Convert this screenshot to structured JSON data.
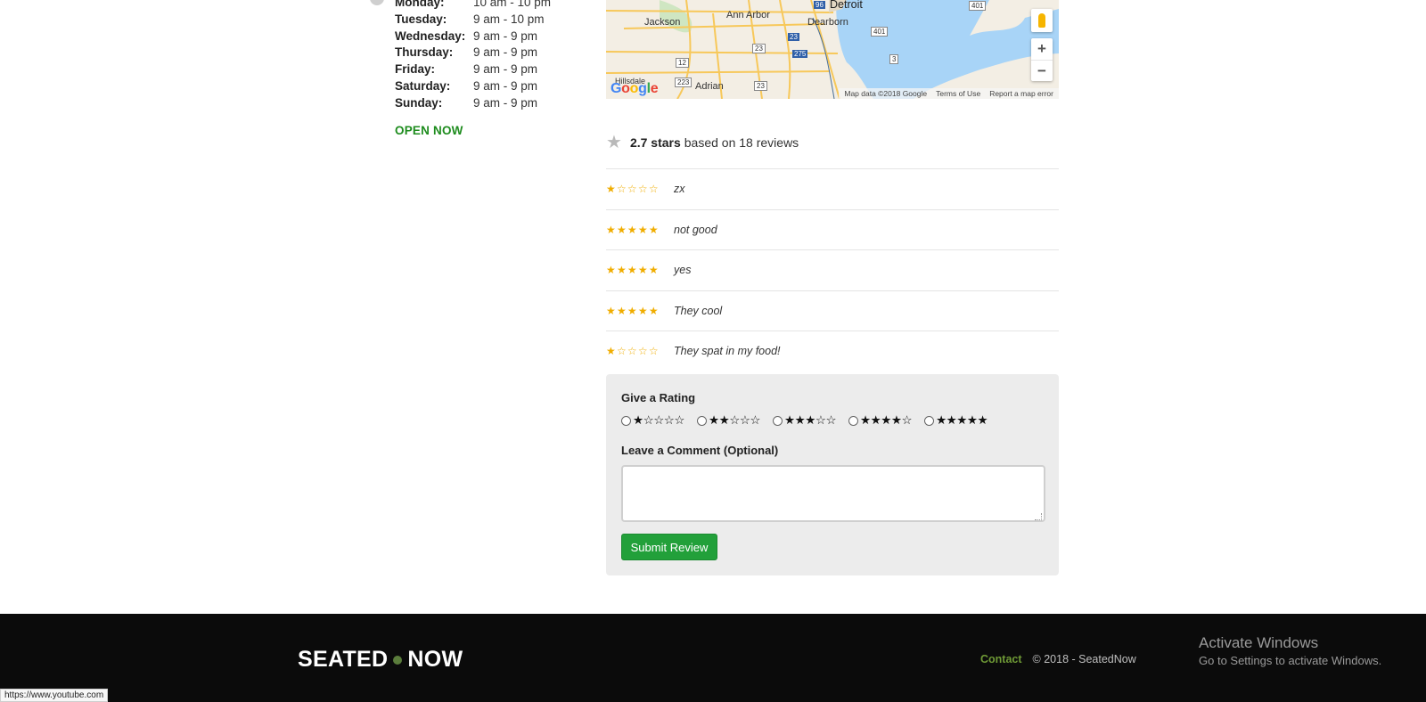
{
  "hours": {
    "rows": [
      {
        "day": "Monday:",
        "time": "10 am - 10 pm"
      },
      {
        "day": "Tuesday:",
        "time": "9 am - 10 pm"
      },
      {
        "day": "Wednesday:",
        "time": "9 am - 9 pm"
      },
      {
        "day": "Thursday:",
        "time": "9 am - 9 pm"
      },
      {
        "day": "Friday:",
        "time": "9 am - 9 pm"
      },
      {
        "day": "Saturday:",
        "time": "9 am - 9 pm"
      },
      {
        "day": "Sunday:",
        "time": "9 am - 9 pm"
      }
    ],
    "status": "OPEN NOW",
    "status_color": "#1e8c1e"
  },
  "map": {
    "cities": [
      "Jackson",
      "Ann Arbor",
      "Detroit",
      "Dearborn",
      "Adrian",
      "Hillsdale"
    ],
    "road_labels": [
      "96",
      "401",
      "401",
      "12",
      "23",
      "275",
      "3",
      "223",
      "23",
      "23"
    ],
    "google_logo": "Google",
    "footer": [
      "Map data ©2018 Google",
      "Terms of Use",
      "Report a map error"
    ],
    "zoom_in": "+",
    "zoom_out": "−",
    "pegman_icon": "street-view-pegman-icon"
  },
  "reviews": {
    "summary": {
      "rating_text": "2.7 stars",
      "suffix": "based on 18 reviews",
      "average": 2.7,
      "count": 18,
      "icon": "star-icon"
    },
    "items": [
      {
        "stars": "★☆☆☆☆",
        "rating": 1,
        "text": "zx"
      },
      {
        "stars": "★★★★★",
        "rating": 5,
        "text": "not good"
      },
      {
        "stars": "★★★★★",
        "rating": 5,
        "text": "yes"
      },
      {
        "stars": "★★★★★",
        "rating": 5,
        "text": "They cool"
      },
      {
        "stars": "★☆☆☆☆",
        "rating": 1,
        "text": "They spat in my food!"
      }
    ],
    "star_color": "#f0ad00"
  },
  "form": {
    "rating_label": "Give a Rating",
    "options": [
      {
        "value": 1,
        "stars": "★☆☆☆☆"
      },
      {
        "value": 2,
        "stars": "★★☆☆☆"
      },
      {
        "value": 3,
        "stars": "★★★☆☆"
      },
      {
        "value": 4,
        "stars": "★★★★☆"
      },
      {
        "value": 5,
        "stars": "★★★★★"
      }
    ],
    "comment_label": "Leave a Comment (Optional)",
    "comment_value": "",
    "submit_label": "Submit Review",
    "submit_color": "#22a03a"
  },
  "footer": {
    "brand_left": "SEATED",
    "brand_right": "NOW",
    "contact": "Contact",
    "copyright": "© 2018 - SeatedNow",
    "windows_title": "Activate Windows",
    "windows_sub": "Go to Settings to activate Windows."
  },
  "status_bar": {
    "url": "https://www.youtube.com"
  }
}
